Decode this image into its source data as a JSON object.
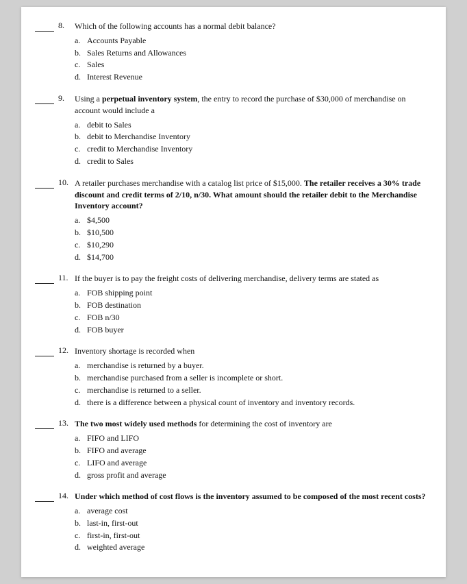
{
  "questions": [
    {
      "number": "8.",
      "text": "Which of the following accounts has a normal debit balance?",
      "bold_text": false,
      "options": [
        {
          "letter": "a.",
          "text": "Accounts Payable"
        },
        {
          "letter": "b.",
          "text": "Sales Returns and Allowances"
        },
        {
          "letter": "c.",
          "text": "Sales"
        },
        {
          "letter": "d.",
          "text": "Interest Revenue"
        }
      ]
    },
    {
      "number": "9.",
      "text": "Using a perpetual inventory system, the entry to record the purchase of $30,000 of merchandise on account would include a",
      "bold_portions": [
        "perpetual inventory system"
      ],
      "options": [
        {
          "letter": "a.",
          "text": "debit to Sales"
        },
        {
          "letter": "b.",
          "text": "debit to Merchandise Inventory"
        },
        {
          "letter": "c.",
          "text": "credit to Merchandise Inventory"
        },
        {
          "letter": "d.",
          "text": "credit to Sales"
        }
      ]
    },
    {
      "number": "10.",
      "text": "A retailer purchases merchandise with a catalog list price of $15,000.  The retailer receives a 30% trade discount and credit terms of 2/10, n/30.  What amount should the retailer debit to the Merchandise Inventory account?",
      "options": [
        {
          "letter": "a.",
          "text": "$4,500"
        },
        {
          "letter": "b.",
          "text": "$10,500"
        },
        {
          "letter": "c.",
          "text": "$10,290"
        },
        {
          "letter": "d.",
          "text": "$14,700"
        }
      ]
    },
    {
      "number": "11.",
      "text": "If the buyer is to pay the freight costs of delivering merchandise, delivery terms are stated as",
      "options": [
        {
          "letter": "a.",
          "text": "FOB shipping point"
        },
        {
          "letter": "b.",
          "text": "FOB destination"
        },
        {
          "letter": "c.",
          "text": "FOB n/30"
        },
        {
          "letter": "d.",
          "text": "FOB buyer"
        }
      ]
    },
    {
      "number": "12.",
      "text": "Inventory shortage is recorded when",
      "options": [
        {
          "letter": "a.",
          "text": "merchandise is returned by a buyer."
        },
        {
          "letter": "b.",
          "text": "merchandise purchased from a seller is incomplete or short."
        },
        {
          "letter": "c.",
          "text": "merchandise is returned to a seller."
        },
        {
          "letter": "d.",
          "text": "there is a difference between a physical count of inventory and inventory records."
        }
      ]
    },
    {
      "number": "13.",
      "text": "The two most widely used methods for determining the cost of inventory are",
      "options": [
        {
          "letter": "a.",
          "text": "FIFO and LIFO"
        },
        {
          "letter": "b.",
          "text": "FIFO and average"
        },
        {
          "letter": "c.",
          "text": "LIFO and average"
        },
        {
          "letter": "d.",
          "text": "gross profit and average"
        }
      ]
    },
    {
      "number": "14.",
      "text": "Under which method of cost flows is the inventory assumed to be composed of the most recent costs?",
      "options": [
        {
          "letter": "a.",
          "text": "average cost"
        },
        {
          "letter": "b.",
          "text": "last-in, first-out"
        },
        {
          "letter": "c.",
          "text": "first-in, first-out"
        },
        {
          "letter": "d.",
          "text": "weighted average"
        }
      ]
    }
  ]
}
